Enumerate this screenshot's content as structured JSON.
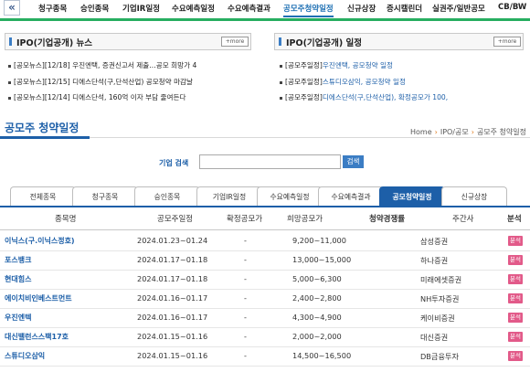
{
  "nav": {
    "back_icon": "«",
    "items": [
      "청구종목",
      "승인종목",
      "기업IR일정",
      "수요예측일정",
      "수요예측결과",
      "공모주청약일정",
      "신규상장",
      "증시캘린더",
      "실권주/일반공모",
      "CB/BW"
    ],
    "active_index": 5
  },
  "news_panel": {
    "title": "IPO(기업공개) 뉴스",
    "more_label": "more",
    "items": [
      "[공모뉴스][12/18] 우진엔택, 증권신고서 제출…공모 희망가 4",
      "[공모뉴스][12/15] 디에스단석(구,단석산업) 공모청약 마감날",
      "[공모뉴스][12/14] 디에스단석, 160억 이자 부담 줄여든다"
    ]
  },
  "schedule_panel": {
    "title": "IPO(기업공개) 일정",
    "more_label": "more",
    "items": [
      {
        "prefix": "[공모주일정]",
        "text": "우진엔택, 공모청약 일정"
      },
      {
        "prefix": "[공모주일정]",
        "text": "스튜디오삼익, 공모청약 일정"
      },
      {
        "prefix": "[공모주일정]",
        "text": "디에스단석(구,단석산업), 확정공모가 100,"
      }
    ]
  },
  "section": {
    "title": "공모주 청약일정",
    "breadcrumb": [
      "Home",
      "IPO/공모",
      "공모주 청약일정"
    ]
  },
  "search": {
    "label": "기업 검색",
    "value": "",
    "placeholder": "",
    "button_label": "검색"
  },
  "tabs": [
    "전체종목",
    "청구종목",
    "승인종목",
    "기업IR일정",
    "수요예측일정",
    "수요예측결과",
    "공모청약일정",
    "신규상장"
  ],
  "active_tab": 6,
  "table": {
    "headers": [
      "종목명",
      "공모주일정",
      "확정공모가",
      "희망공모가",
      "청약경쟁률",
      "주간사",
      "분석"
    ],
    "rows": [
      {
        "name": "이닉스(구.이닉스정호)",
        "schedule": "2024.01.23~01.24",
        "fixed": "-",
        "hope": "9,200~11,000",
        "ratio": "",
        "underwriter": "삼성증권",
        "analysis": "분석"
      },
      {
        "name": "포스뱅크",
        "schedule": "2024.01.17~01.18",
        "fixed": "-",
        "hope": "13,000~15,000",
        "ratio": "",
        "underwriter": "하나증권",
        "analysis": "분석"
      },
      {
        "name": "현대힘스",
        "schedule": "2024.01.17~01.18",
        "fixed": "-",
        "hope": "5,000~6,300",
        "ratio": "",
        "underwriter": "미래에셋증권",
        "analysis": "분석"
      },
      {
        "name": "에이치비인베스트먼트",
        "schedule": "2024.01.16~01.17",
        "fixed": "-",
        "hope": "2,400~2,800",
        "ratio": "",
        "underwriter": "NH투자증권",
        "analysis": "분석"
      },
      {
        "name": "우진엔텍",
        "schedule": "2024.01.16~01.17",
        "fixed": "-",
        "hope": "4,300~4,900",
        "ratio": "",
        "underwriter": "케이비증권",
        "analysis": "분석"
      },
      {
        "name": "대신밸런스스팩17호",
        "schedule": "2024.01.15~01.16",
        "fixed": "-",
        "hope": "2,000~2,000",
        "ratio": "",
        "underwriter": "대신증권",
        "analysis": "분석"
      },
      {
        "name": "스튜디오삼익",
        "schedule": "2024.01.15~01.16",
        "fixed": "-",
        "hope": "14,500~16,500",
        "ratio": "",
        "underwriter": "DB금융투자",
        "analysis": "분석"
      }
    ]
  },
  "colors": {
    "accent": "#1d5fa8",
    "nav_bar": "#27ae60",
    "badge": "#e25a89"
  }
}
